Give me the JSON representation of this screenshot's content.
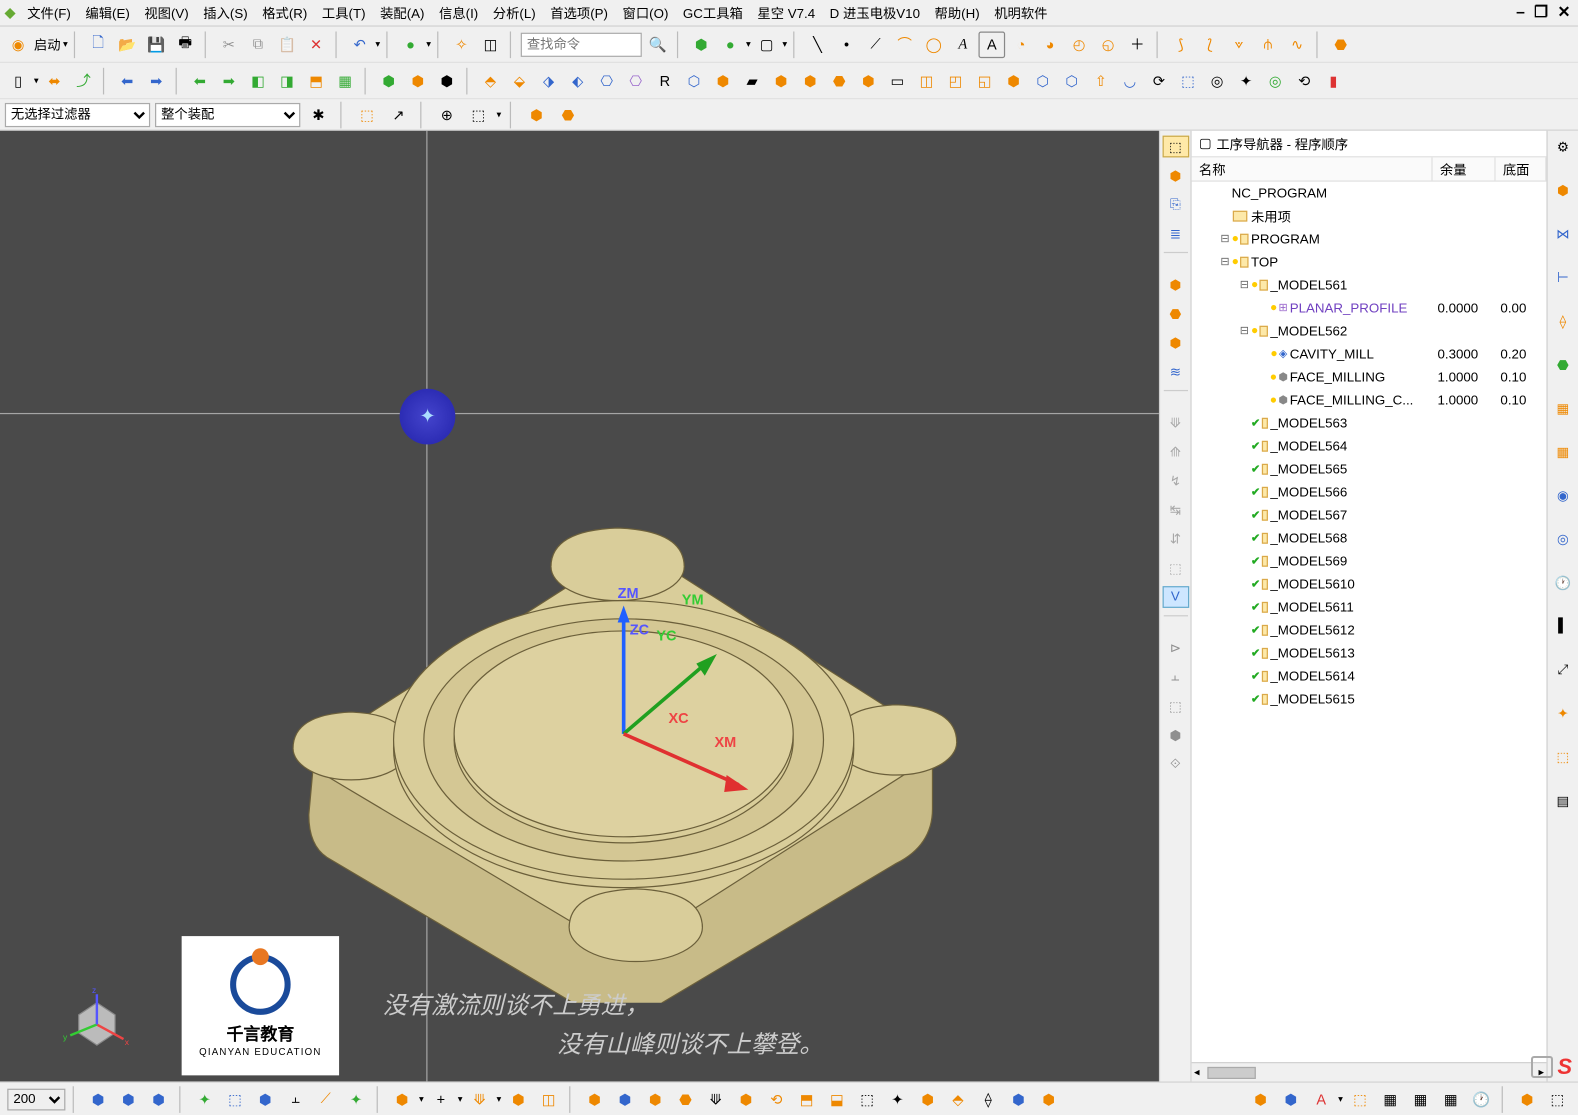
{
  "menu": {
    "items": [
      "文件(F)",
      "编辑(E)",
      "视图(V)",
      "插入(S)",
      "格式(R)",
      "工具(T)",
      "装配(A)",
      "信息(I)",
      "分析(L)",
      "首选项(P)",
      "窗口(O)",
      "GC工具箱",
      "星空 V7.4",
      "D 进玉电极V10",
      "帮助(H)",
      "机明软件"
    ]
  },
  "win_btns": "– ❐ ✕",
  "toolbar1": {
    "start": "启动",
    "search_ph": "查找命令"
  },
  "toolbar3": {
    "filter": "无选择过滤器",
    "scope": "整个装配"
  },
  "viewport": {
    "axes": {
      "zm": "ZM",
      "ym": "YM",
      "zc": "ZC",
      "yc": "YC",
      "xc": "XC",
      "xm": "XM"
    },
    "caption1": "没有激流则谈不上勇进，",
    "caption2": "没有山峰则谈不上攀登。",
    "logo_cn": "千言教育",
    "logo_en": "QIANYAN EDUCATION"
  },
  "nav": {
    "title": "工序导航器 - 程序顺序",
    "cols": {
      "name": "名称",
      "c1": "余量",
      "c2": "底面"
    },
    "tree": [
      {
        "d": 0,
        "exp": "",
        "ic": "",
        "name": "NC_PROGRAM"
      },
      {
        "d": 1,
        "exp": "",
        "ic": "f",
        "name": "未用项"
      },
      {
        "d": 1,
        "exp": "-",
        "ic": "bf",
        "name": "PROGRAM"
      },
      {
        "d": 1,
        "exp": "-",
        "ic": "bf",
        "name": "TOP"
      },
      {
        "d": 2,
        "exp": "-",
        "ic": "bf",
        "name": "_MODEL561"
      },
      {
        "d": 3,
        "exp": "",
        "ic": "bp",
        "name": "PLANAR_PROFILE",
        "purple": true,
        "c1": "0.0000",
        "c2": "0.00"
      },
      {
        "d": 2,
        "exp": "-",
        "ic": "bf",
        "name": "_MODEL562"
      },
      {
        "d": 3,
        "exp": "",
        "ic": "bc",
        "name": "CAVITY_MILL",
        "c1": "0.3000",
        "c2": "0.20"
      },
      {
        "d": 3,
        "exp": "",
        "ic": "bm",
        "name": "FACE_MILLING",
        "c1": "1.0000",
        "c2": "0.10"
      },
      {
        "d": 3,
        "exp": "",
        "ic": "bm",
        "name": "FACE_MILLING_C...",
        "c1": "1.0000",
        "c2": "0.10"
      },
      {
        "d": 2,
        "exp": "",
        "ic": "gf",
        "name": "_MODEL563"
      },
      {
        "d": 2,
        "exp": "",
        "ic": "gf",
        "name": "_MODEL564"
      },
      {
        "d": 2,
        "exp": "",
        "ic": "gf",
        "name": "_MODEL565"
      },
      {
        "d": 2,
        "exp": "",
        "ic": "gf",
        "name": "_MODEL566"
      },
      {
        "d": 2,
        "exp": "",
        "ic": "gf",
        "name": "_MODEL567"
      },
      {
        "d": 2,
        "exp": "",
        "ic": "gf",
        "name": "_MODEL568"
      },
      {
        "d": 2,
        "exp": "",
        "ic": "gf",
        "name": "_MODEL569"
      },
      {
        "d": 2,
        "exp": "",
        "ic": "gf",
        "name": "_MODEL5610"
      },
      {
        "d": 2,
        "exp": "",
        "ic": "gf",
        "name": "_MODEL5611"
      },
      {
        "d": 2,
        "exp": "",
        "ic": "gf",
        "name": "_MODEL5612"
      },
      {
        "d": 2,
        "exp": "",
        "ic": "gf",
        "name": "_MODEL5613"
      },
      {
        "d": 2,
        "exp": "",
        "ic": "gf",
        "name": "_MODEL5614"
      },
      {
        "d": 2,
        "exp": "",
        "ic": "gf",
        "name": "_MODEL5615"
      }
    ]
  },
  "bottom": {
    "zoom": "200"
  },
  "sogou": "S"
}
